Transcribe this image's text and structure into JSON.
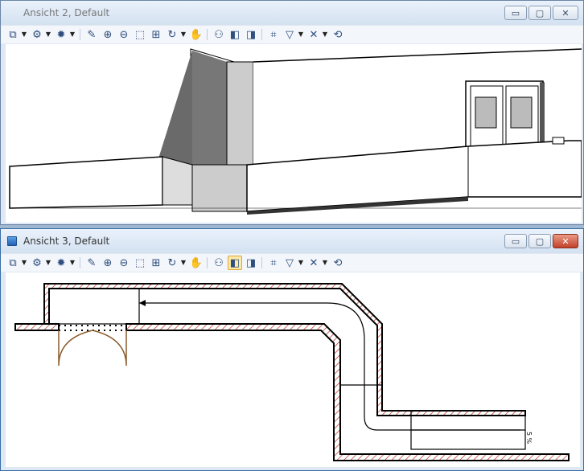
{
  "windows": [
    {
      "title": "Ansicht 2, Default",
      "active": false,
      "caption_buttons": {
        "minimize": "▭",
        "maximize": "▢",
        "close": "✕"
      },
      "toolbar": [
        {
          "name": "view-attributes-icon",
          "glyph": "⧉",
          "dropdown": true
        },
        {
          "name": "display-style-icon",
          "glyph": "⚙",
          "dropdown": true
        },
        {
          "name": "lighting-icon",
          "glyph": "✹",
          "dropdown": true
        },
        {
          "name": "update-view-icon",
          "glyph": "✎"
        },
        {
          "name": "zoom-in-icon",
          "glyph": "⊕"
        },
        {
          "name": "zoom-out-icon",
          "glyph": "⊖"
        },
        {
          "name": "window-area-icon",
          "glyph": "⬚"
        },
        {
          "name": "fit-view-icon",
          "glyph": "⊞"
        },
        {
          "name": "rotate-view-icon",
          "glyph": "↻",
          "dropdown": true
        },
        {
          "name": "pan-view-icon",
          "glyph": "✋"
        },
        {
          "name": "walk-icon",
          "glyph": "⚇"
        },
        {
          "name": "previous-view-icon",
          "glyph": "◧"
        },
        {
          "name": "next-view-icon",
          "glyph": "◨"
        },
        {
          "name": "clip-volume-icon",
          "glyph": "⌗"
        },
        {
          "name": "view-filter-icon",
          "glyph": "▽",
          "dropdown": true
        },
        {
          "name": "view-tools-icon",
          "glyph": "✕",
          "dropdown": true
        },
        {
          "name": "view-toggle-icon",
          "glyph": "⟲"
        }
      ]
    },
    {
      "title": "Ansicht 3, Default",
      "active": true,
      "caption_buttons": {
        "minimize": "▭",
        "maximize": "▢",
        "close": "✕"
      },
      "toolbar": [
        {
          "name": "view-attributes-icon",
          "glyph": "⧉",
          "dropdown": true
        },
        {
          "name": "display-style-icon",
          "glyph": "⚙",
          "dropdown": true
        },
        {
          "name": "lighting-icon",
          "glyph": "✹",
          "dropdown": true
        },
        {
          "name": "update-view-icon",
          "glyph": "✎"
        },
        {
          "name": "zoom-in-icon",
          "glyph": "⊕"
        },
        {
          "name": "zoom-out-icon",
          "glyph": "⊖"
        },
        {
          "name": "window-area-icon",
          "glyph": "⬚"
        },
        {
          "name": "fit-view-icon",
          "glyph": "⊞"
        },
        {
          "name": "rotate-view-icon",
          "glyph": "↻",
          "dropdown": true
        },
        {
          "name": "pan-view-icon",
          "glyph": "✋"
        },
        {
          "name": "walk-icon",
          "glyph": "⚇"
        },
        {
          "name": "previous-view-icon",
          "glyph": "◧",
          "selected": true
        },
        {
          "name": "next-view-icon",
          "glyph": "◨"
        },
        {
          "name": "clip-volume-icon",
          "glyph": "⌗"
        },
        {
          "name": "view-filter-icon",
          "glyph": "▽",
          "dropdown": true
        },
        {
          "name": "view-tools-icon",
          "glyph": "✕",
          "dropdown": true
        },
        {
          "name": "view-toggle-icon",
          "glyph": "⟲"
        }
      ],
      "drawing": {
        "slope_label": "5 %"
      }
    }
  ]
}
